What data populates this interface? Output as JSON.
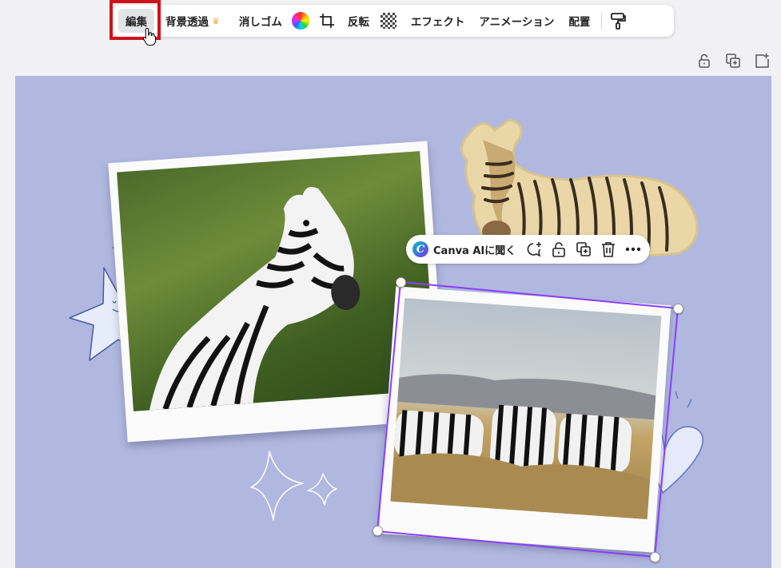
{
  "toolbar": {
    "edit_label": "編集",
    "bg_remove_label": "背景透過",
    "eraser_label": "消しゴム",
    "flip_label": "反転",
    "effects_label": "エフェクト",
    "animation_label": "アニメーション",
    "position_label": "配置"
  },
  "element_menu": {
    "ask_ai_label": "Canva AIに聞く"
  },
  "icons": {
    "crown": "crown-icon",
    "color": "color-wheel-icon",
    "crop": "crop-icon",
    "transparency": "transparency-icon",
    "paint_roller": "copy-style-icon",
    "lock": "lock-icon",
    "duplicate": "duplicate-icon",
    "add_page": "add-page-icon",
    "comment": "comment-icon",
    "trash": "trash-icon",
    "more": "more-icon"
  },
  "colors": {
    "canvas_background": "#b0b8e0",
    "selection": "#8b3dff",
    "highlight": "#d0121b",
    "crown": "#f2a93b"
  }
}
